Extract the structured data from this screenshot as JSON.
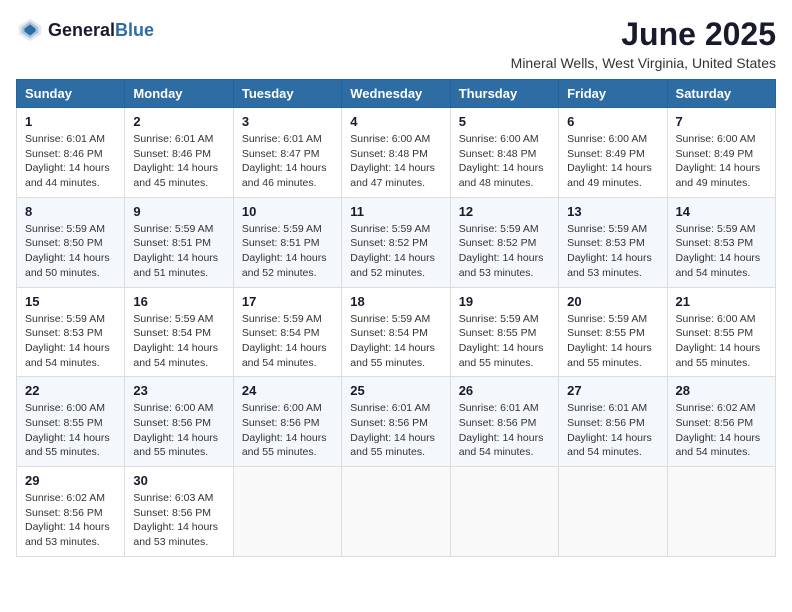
{
  "header": {
    "logo_general": "General",
    "logo_blue": "Blue",
    "month": "June 2025",
    "location": "Mineral Wells, West Virginia, United States"
  },
  "days_of_week": [
    "Sunday",
    "Monday",
    "Tuesday",
    "Wednesday",
    "Thursday",
    "Friday",
    "Saturday"
  ],
  "weeks": [
    [
      {
        "day": "1",
        "sunrise": "6:01 AM",
        "sunset": "8:46 PM",
        "daylight": "14 hours and 44 minutes."
      },
      {
        "day": "2",
        "sunrise": "6:01 AM",
        "sunset": "8:46 PM",
        "daylight": "14 hours and 45 minutes."
      },
      {
        "day": "3",
        "sunrise": "6:01 AM",
        "sunset": "8:47 PM",
        "daylight": "14 hours and 46 minutes."
      },
      {
        "day": "4",
        "sunrise": "6:00 AM",
        "sunset": "8:48 PM",
        "daylight": "14 hours and 47 minutes."
      },
      {
        "day": "5",
        "sunrise": "6:00 AM",
        "sunset": "8:48 PM",
        "daylight": "14 hours and 48 minutes."
      },
      {
        "day": "6",
        "sunrise": "6:00 AM",
        "sunset": "8:49 PM",
        "daylight": "14 hours and 49 minutes."
      },
      {
        "day": "7",
        "sunrise": "6:00 AM",
        "sunset": "8:49 PM",
        "daylight": "14 hours and 49 minutes."
      }
    ],
    [
      {
        "day": "8",
        "sunrise": "5:59 AM",
        "sunset": "8:50 PM",
        "daylight": "14 hours and 50 minutes."
      },
      {
        "day": "9",
        "sunrise": "5:59 AM",
        "sunset": "8:51 PM",
        "daylight": "14 hours and 51 minutes."
      },
      {
        "day": "10",
        "sunrise": "5:59 AM",
        "sunset": "8:51 PM",
        "daylight": "14 hours and 52 minutes."
      },
      {
        "day": "11",
        "sunrise": "5:59 AM",
        "sunset": "8:52 PM",
        "daylight": "14 hours and 52 minutes."
      },
      {
        "day": "12",
        "sunrise": "5:59 AM",
        "sunset": "8:52 PM",
        "daylight": "14 hours and 53 minutes."
      },
      {
        "day": "13",
        "sunrise": "5:59 AM",
        "sunset": "8:53 PM",
        "daylight": "14 hours and 53 minutes."
      },
      {
        "day": "14",
        "sunrise": "5:59 AM",
        "sunset": "8:53 PM",
        "daylight": "14 hours and 54 minutes."
      }
    ],
    [
      {
        "day": "15",
        "sunrise": "5:59 AM",
        "sunset": "8:53 PM",
        "daylight": "14 hours and 54 minutes."
      },
      {
        "day": "16",
        "sunrise": "5:59 AM",
        "sunset": "8:54 PM",
        "daylight": "14 hours and 54 minutes."
      },
      {
        "day": "17",
        "sunrise": "5:59 AM",
        "sunset": "8:54 PM",
        "daylight": "14 hours and 54 minutes."
      },
      {
        "day": "18",
        "sunrise": "5:59 AM",
        "sunset": "8:54 PM",
        "daylight": "14 hours and 55 minutes."
      },
      {
        "day": "19",
        "sunrise": "5:59 AM",
        "sunset": "8:55 PM",
        "daylight": "14 hours and 55 minutes."
      },
      {
        "day": "20",
        "sunrise": "5:59 AM",
        "sunset": "8:55 PM",
        "daylight": "14 hours and 55 minutes."
      },
      {
        "day": "21",
        "sunrise": "6:00 AM",
        "sunset": "8:55 PM",
        "daylight": "14 hours and 55 minutes."
      }
    ],
    [
      {
        "day": "22",
        "sunrise": "6:00 AM",
        "sunset": "8:55 PM",
        "daylight": "14 hours and 55 minutes."
      },
      {
        "day": "23",
        "sunrise": "6:00 AM",
        "sunset": "8:56 PM",
        "daylight": "14 hours and 55 minutes."
      },
      {
        "day": "24",
        "sunrise": "6:00 AM",
        "sunset": "8:56 PM",
        "daylight": "14 hours and 55 minutes."
      },
      {
        "day": "25",
        "sunrise": "6:01 AM",
        "sunset": "8:56 PM",
        "daylight": "14 hours and 55 minutes."
      },
      {
        "day": "26",
        "sunrise": "6:01 AM",
        "sunset": "8:56 PM",
        "daylight": "14 hours and 54 minutes."
      },
      {
        "day": "27",
        "sunrise": "6:01 AM",
        "sunset": "8:56 PM",
        "daylight": "14 hours and 54 minutes."
      },
      {
        "day": "28",
        "sunrise": "6:02 AM",
        "sunset": "8:56 PM",
        "daylight": "14 hours and 54 minutes."
      }
    ],
    [
      {
        "day": "29",
        "sunrise": "6:02 AM",
        "sunset": "8:56 PM",
        "daylight": "14 hours and 53 minutes."
      },
      {
        "day": "30",
        "sunrise": "6:03 AM",
        "sunset": "8:56 PM",
        "daylight": "14 hours and 53 minutes."
      },
      null,
      null,
      null,
      null,
      null
    ]
  ]
}
